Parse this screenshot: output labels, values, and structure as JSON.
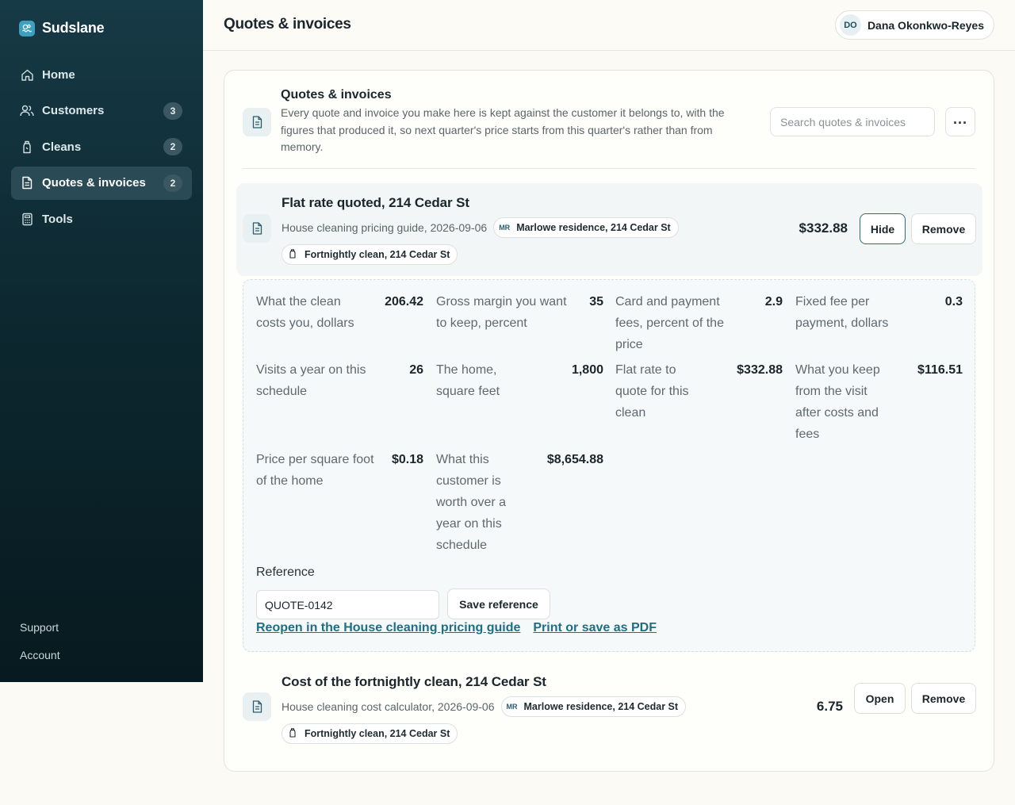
{
  "app": {
    "name": "Sudslane"
  },
  "sidebar": {
    "items": [
      {
        "label": "Home",
        "badge": null
      },
      {
        "label": "Customers",
        "badge": "3"
      },
      {
        "label": "Cleans",
        "badge": "2"
      },
      {
        "label": "Quotes & invoices",
        "badge": "2"
      },
      {
        "label": "Tools",
        "badge": null
      }
    ],
    "bottom": {
      "support": "Support",
      "account": "Account"
    }
  },
  "header": {
    "title": "Quotes & invoices",
    "user": {
      "initials": "DO",
      "name": "Dana Okonkwo-Reyes"
    }
  },
  "card": {
    "title": "Quotes & invoices",
    "description": "Every quote and invoice you make here is kept against the customer it belongs to, with the figures that produced it, so next quarter's price starts from this quarter's rather than from memory.",
    "search_placeholder": "Search quotes & invoices",
    "more_label": "..."
  },
  "records": [
    {
      "title": "Flat rate quoted, 214 Cedar St",
      "source": "House cleaning pricing guide, 2026-09-06",
      "customer": {
        "initials": "MR",
        "label": "Marlowe residence, 214 Cedar St"
      },
      "clean": "Fortnightly clean, 214 Cedar St",
      "amount": "$332.88",
      "toggle_label": "Hide",
      "remove_label": "Remove",
      "fields": [
        {
          "label": "What the clean costs you, dollars",
          "value": "206.42"
        },
        {
          "label": "Gross margin you want to keep, percent",
          "value": "35"
        },
        {
          "label": "Card and payment fees, percent of the price",
          "value": "2.9"
        },
        {
          "label": "Fixed fee per payment, dollars",
          "value": "0.3"
        },
        {
          "label": "Visits a year on this schedule",
          "value": "26"
        },
        {
          "label": "The home, square feet",
          "value": "1,800"
        },
        {
          "label": "Flat rate to quote for this clean",
          "value": "$332.88"
        },
        {
          "label": "What you keep from the visit after costs and fees",
          "value": "$116.51"
        },
        {
          "label": "Price per square foot of the home",
          "value": "$0.18"
        },
        {
          "label": "What this customer is worth over a year on this schedule",
          "value": "$8,654.88"
        }
      ],
      "reference": {
        "label": "Reference",
        "value": "QUOTE-0142",
        "save_label": "Save reference"
      },
      "links": {
        "reopen": "Reopen in the House cleaning pricing guide",
        "print": "Print or save as PDF"
      }
    },
    {
      "title": "Cost of the fortnightly clean, 214 Cedar St",
      "source": "House cleaning cost calculator, 2026-09-06",
      "customer": {
        "initials": "MR",
        "label": "Marlowe residence, 214 Cedar St"
      },
      "clean": "Fortnightly clean, 214 Cedar St",
      "amount": "6.75",
      "toggle_label": "Open",
      "remove_label": "Remove"
    }
  ],
  "colors": {
    "accent": "#1e6e86",
    "sidebar": "#0d2830",
    "brand": "#3f9fbe"
  }
}
